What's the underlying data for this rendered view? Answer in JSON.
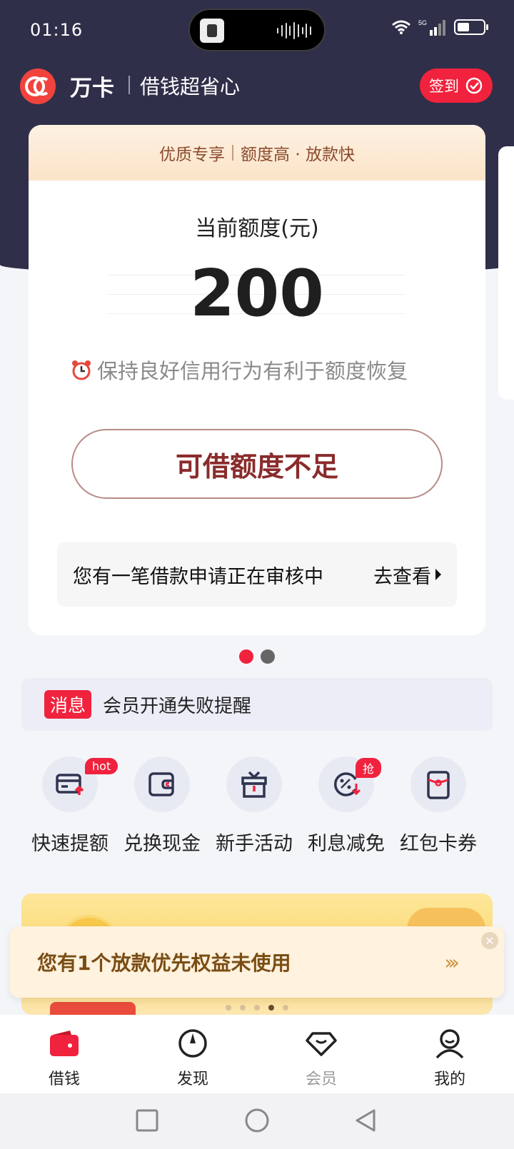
{
  "status_bar": {
    "time": "01:16",
    "network": "5G"
  },
  "header": {
    "app_name": "万卡",
    "slogan": "借钱超省心",
    "signin_label": "签到"
  },
  "card": {
    "banner_left": "优质专享",
    "banner_right": "额度高 · 放款快",
    "limit_label": "当前额度(元)",
    "limit_amount": "200",
    "hint": "保持良好信用行为有利于额度恢复",
    "main_button": "可借额度不足",
    "review_text": "您有一笔借款申请正在审核中",
    "review_link": "去查看"
  },
  "pager": {
    "count": 2,
    "active": 0
  },
  "message": {
    "tag": "消息",
    "text": "会员开通失败提醒"
  },
  "quick_actions": [
    {
      "label": "快速提额",
      "icon": "card-up-icon",
      "badge": "hot"
    },
    {
      "label": "兑换现金",
      "icon": "wallet-icon",
      "badge": ""
    },
    {
      "label": "新手活动",
      "icon": "gift-icon",
      "badge": ""
    },
    {
      "label": "利息减免",
      "icon": "discount-icon",
      "badge": "抢"
    },
    {
      "label": "红包卡券",
      "icon": "red-envelope-icon",
      "badge": ""
    }
  ],
  "promo": {
    "priority_text": "您有1个放款优先权益未使用",
    "arrows": "›››",
    "slide_count": 5,
    "active_slide": 3
  },
  "tabs": [
    {
      "label": "借钱",
      "icon": "borrow-wallet-icon",
      "active": true
    },
    {
      "label": "发现",
      "icon": "compass-icon",
      "active": false
    },
    {
      "label": "会员",
      "icon": "diamond-icon",
      "active": false
    },
    {
      "label": "我的",
      "icon": "profile-icon",
      "active": false
    }
  ],
  "colors": {
    "accent": "#f0223d",
    "header_bg": "#2f2f4a",
    "button_text": "#8a2b2b"
  }
}
